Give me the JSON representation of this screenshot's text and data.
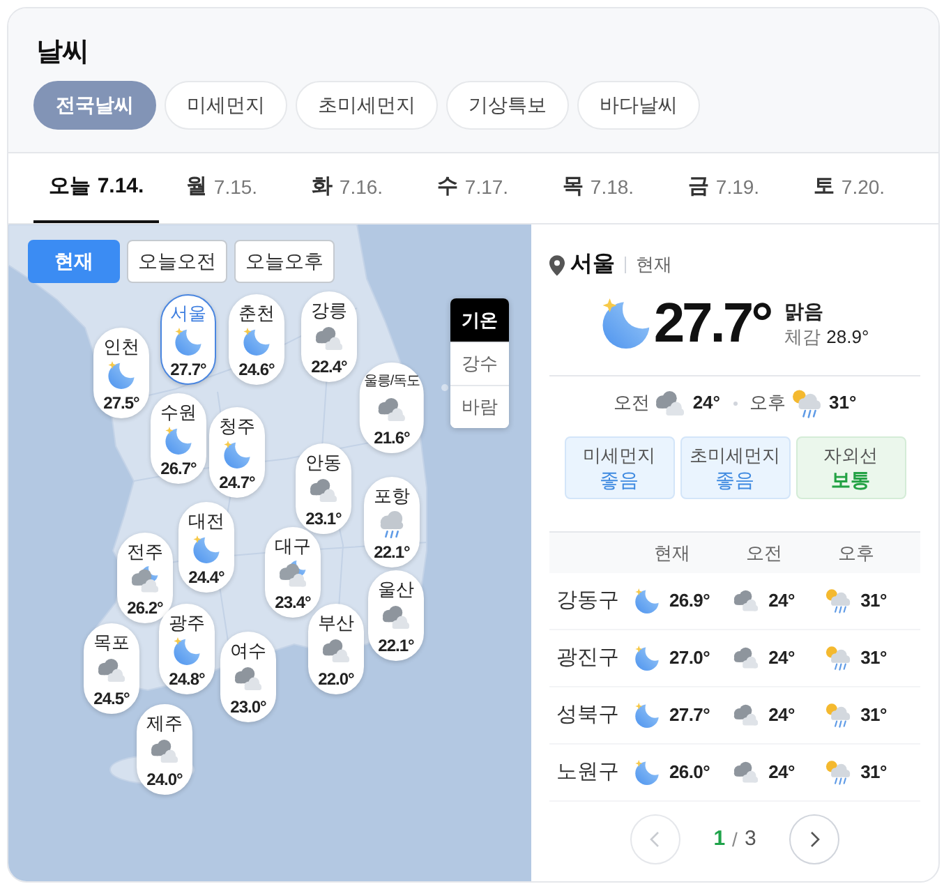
{
  "header": {
    "title": "날씨"
  },
  "category_tabs": [
    {
      "label": "전국날씨",
      "selected": true
    },
    {
      "label": "미세먼지",
      "selected": false
    },
    {
      "label": "초미세먼지",
      "selected": false
    },
    {
      "label": "기상특보",
      "selected": false
    },
    {
      "label": "바다날씨",
      "selected": false
    }
  ],
  "date_tabs": [
    {
      "day": "오늘",
      "date": "7.14.",
      "selected": true
    },
    {
      "day": "월",
      "date": "7.15.",
      "selected": false
    },
    {
      "day": "화",
      "date": "7.16.",
      "selected": false
    },
    {
      "day": "수",
      "date": "7.17.",
      "selected": false
    },
    {
      "day": "목",
      "date": "7.18.",
      "selected": false
    },
    {
      "day": "금",
      "date": "7.19.",
      "selected": false
    },
    {
      "day": "토",
      "date": "7.20.",
      "selected": false
    }
  ],
  "map": {
    "time_tabs": [
      {
        "label": "현재",
        "selected": true
      },
      {
        "label": "오늘오전",
        "selected": false
      },
      {
        "label": "오늘오후",
        "selected": false
      }
    ],
    "layer_tabs": [
      {
        "label": "기온",
        "selected": true
      },
      {
        "label": "강수",
        "selected": false
      },
      {
        "label": "바람",
        "selected": false
      }
    ],
    "cities": [
      {
        "name": "인천",
        "kind": "moon",
        "temperature": "27.5°",
        "selected": false
      },
      {
        "name": "서울",
        "kind": "moon",
        "temperature": "27.7°",
        "selected": true
      },
      {
        "name": "춘천",
        "kind": "moon",
        "temperature": "24.6°",
        "selected": false
      },
      {
        "name": "강릉",
        "kind": "cloud",
        "temperature": "22.4°",
        "selected": false
      },
      {
        "name": "울릉/독도",
        "kind": "cloud",
        "temperature": "21.6°",
        "selected": false
      },
      {
        "name": "수원",
        "kind": "moon",
        "temperature": "26.7°",
        "selected": false
      },
      {
        "name": "청주",
        "kind": "moon",
        "temperature": "24.7°",
        "selected": false
      },
      {
        "name": "안동",
        "kind": "cloud",
        "temperature": "23.1°",
        "selected": false
      },
      {
        "name": "포항",
        "kind": "rain",
        "temperature": "22.1°",
        "selected": false
      },
      {
        "name": "대전",
        "kind": "moon",
        "temperature": "24.4°",
        "selected": false
      },
      {
        "name": "전주",
        "kind": "moon_cloud",
        "temperature": "26.2°",
        "selected": false
      },
      {
        "name": "대구",
        "kind": "moon_cloud",
        "temperature": "23.4°",
        "selected": false
      },
      {
        "name": "울산",
        "kind": "cloud",
        "temperature": "22.1°",
        "selected": false
      },
      {
        "name": "광주",
        "kind": "moon",
        "temperature": "24.8°",
        "selected": false
      },
      {
        "name": "부산",
        "kind": "cloud",
        "temperature": "22.0°",
        "selected": false
      },
      {
        "name": "목포",
        "kind": "cloud",
        "temperature": "24.5°",
        "selected": false
      },
      {
        "name": "여수",
        "kind": "cloud",
        "temperature": "23.0°",
        "selected": false
      },
      {
        "name": "제주",
        "kind": "cloud",
        "temperature": "24.0°",
        "selected": false
      }
    ]
  },
  "current": {
    "location": "서울",
    "time_label": "현재",
    "kind": "moon",
    "temperature": "27.7°",
    "condition": "맑음",
    "feels_label": "체감",
    "feels_value": "28.9°",
    "forecast": [
      {
        "label": "오전",
        "kind": "cloud",
        "temperature": "24°"
      },
      {
        "label": "오후",
        "kind": "sun_rain",
        "temperature": "31°"
      }
    ],
    "indices": [
      {
        "label": "미세먼지",
        "value": "좋음",
        "kind": "good"
      },
      {
        "label": "초미세먼지",
        "value": "좋음",
        "kind": "good"
      },
      {
        "label": "자외선",
        "value": "보통",
        "kind": "normal"
      }
    ]
  },
  "district_table": {
    "columns": [
      "현재",
      "오전",
      "오후"
    ],
    "rows": [
      {
        "district": "강동구",
        "cells": [
          {
            "kind": "moon",
            "temperature": "26.9°"
          },
          {
            "kind": "cloud",
            "temperature": "24°"
          },
          {
            "kind": "sun_rain",
            "temperature": "31°"
          }
        ]
      },
      {
        "district": "광진구",
        "cells": [
          {
            "kind": "moon",
            "temperature": "27.0°"
          },
          {
            "kind": "cloud",
            "temperature": "24°"
          },
          {
            "kind": "sun_rain",
            "temperature": "31°"
          }
        ]
      },
      {
        "district": "성북구",
        "cells": [
          {
            "kind": "moon",
            "temperature": "27.7°"
          },
          {
            "kind": "cloud",
            "temperature": "24°"
          },
          {
            "kind": "sun_rain",
            "temperature": "31°"
          }
        ]
      },
      {
        "district": "노원구",
        "cells": [
          {
            "kind": "moon",
            "temperature": "26.0°"
          },
          {
            "kind": "cloud",
            "temperature": "24°"
          },
          {
            "kind": "sun_rain",
            "temperature": "31°"
          }
        ]
      }
    ]
  },
  "pager": {
    "current_page": "1",
    "separator": "/",
    "total_pages": "3",
    "previous": {
      "disabled": true
    },
    "next": {
      "disabled": false
    }
  }
}
